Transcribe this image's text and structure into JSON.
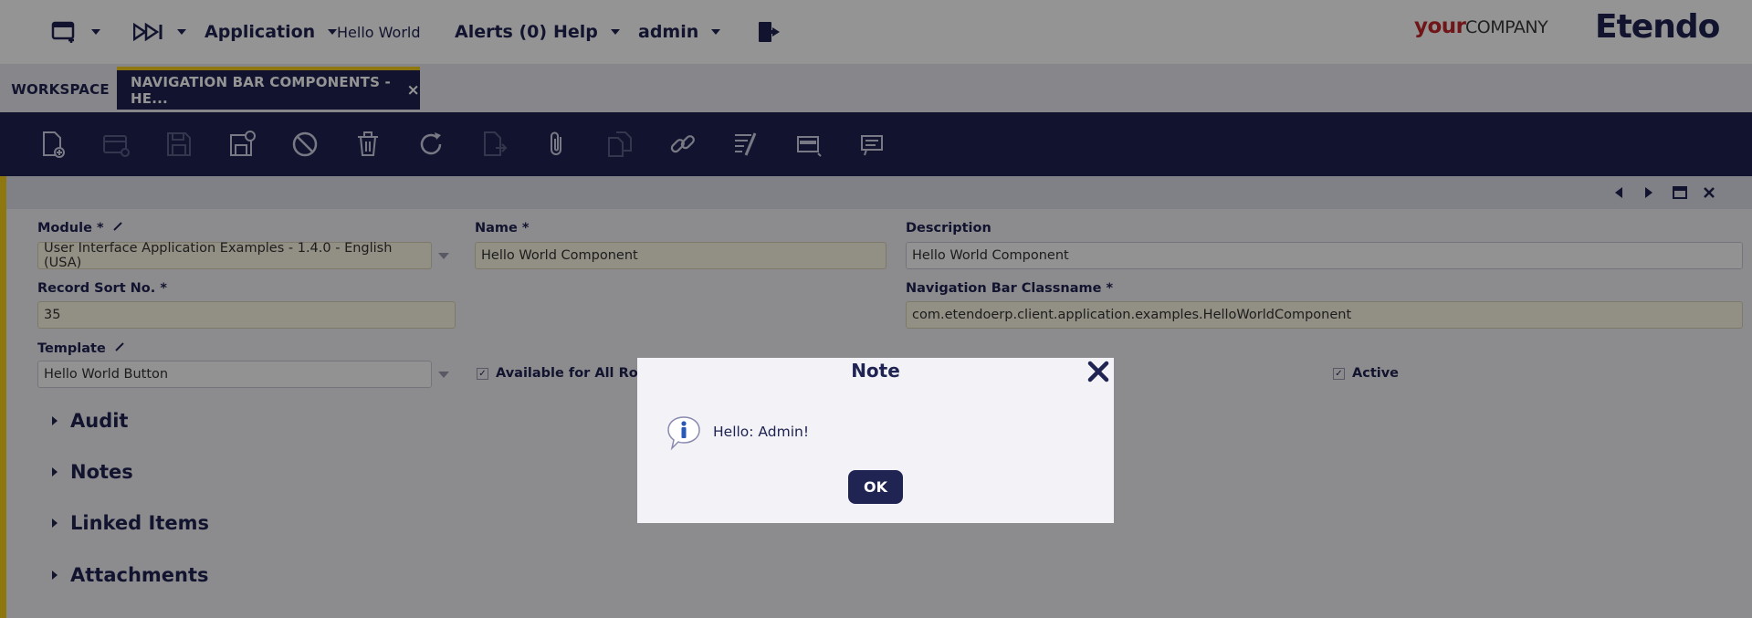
{
  "topbar": {
    "application_menu": "Application",
    "recent_view": "Hello World",
    "alerts": "Alerts (0)",
    "help_menu": "Help",
    "user_menu": "admin",
    "logo_your": "your",
    "logo_company": "COMPANY",
    "logo_brand": "Etendo"
  },
  "tabs": {
    "workspace": "WORKSPACE",
    "active": "NAVIGATION BAR COMPONENTS - HE...",
    "close_glyph": "×"
  },
  "form": {
    "module_label": "Module *",
    "module_value": "User Interface Application Examples - 1.4.0 - English (USA)",
    "name_label": "Name *",
    "name_value": "Hello World Component",
    "description_label": "Description",
    "description_value": "Hello World Component",
    "sort_label": "Record Sort No. *",
    "sort_value": "35",
    "classname_label": "Navigation Bar Classname *",
    "classname_value": "com.etendoerp.client.application.examples.HelloWorldComponent",
    "template_label": "Template",
    "template_value": "Hello World Button",
    "available_label": "Available for All Roles",
    "active_label": "Active",
    "check_glyph": "✓"
  },
  "sections": [
    "Audit",
    "Notes",
    "Linked Items",
    "Attachments"
  ],
  "dialog": {
    "title": "Note",
    "message": "Hello: Admin!",
    "ok_label": "OK"
  },
  "colors": {
    "navy": "#202452",
    "accent_yellow": "#f5cd1b",
    "required_field_bg": "#fbf6e3",
    "logo_red": "#c2262b"
  }
}
